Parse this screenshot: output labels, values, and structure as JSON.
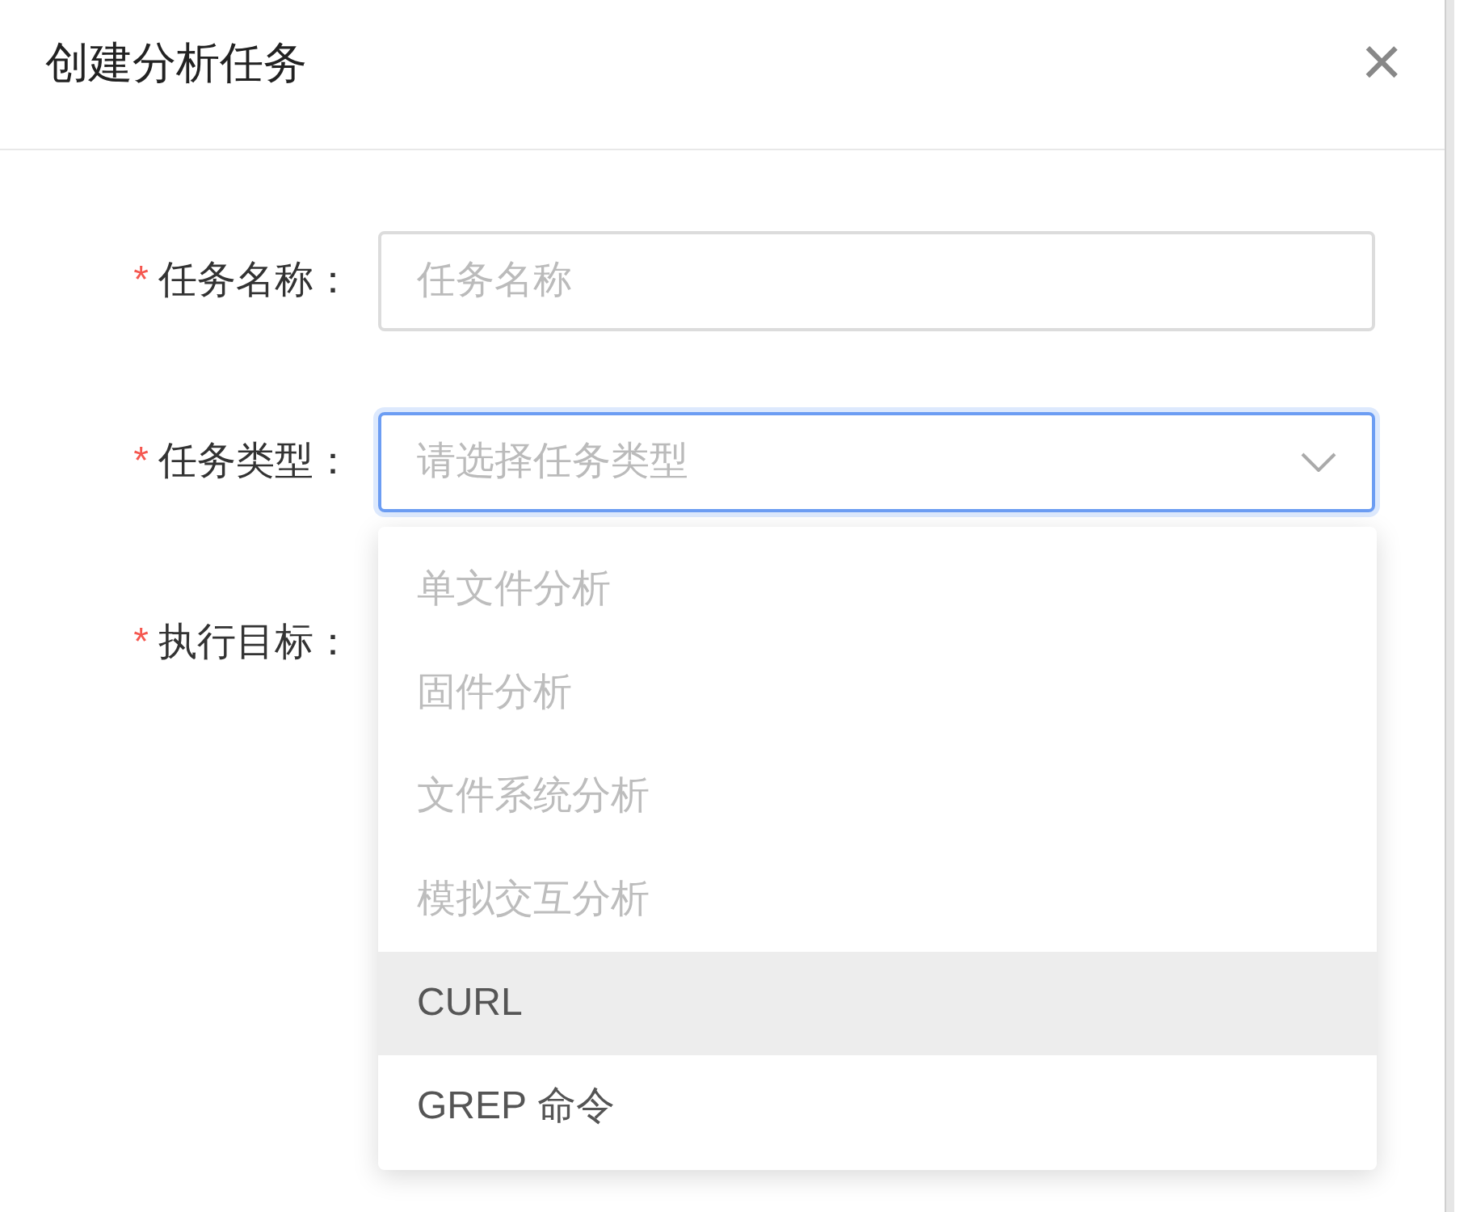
{
  "dialog": {
    "title": "创建分析任务",
    "close": "×"
  },
  "fields": [
    {
      "required_mark": "*",
      "label": "任务名称：",
      "kind": "input",
      "placeholder": "任务名称"
    },
    {
      "required_mark": "*",
      "label": "任务类型：",
      "kind": "select",
      "placeholder": "请选择任务类型",
      "focused": true
    },
    {
      "required_mark": "*",
      "label": "执行目标：",
      "kind": "none"
    }
  ],
  "dropdown": {
    "options": [
      {
        "label": "单文件分析",
        "disabled": true,
        "highlighted": false
      },
      {
        "label": "固件分析",
        "disabled": true,
        "highlighted": false
      },
      {
        "label": "文件系统分析",
        "disabled": true,
        "highlighted": false
      },
      {
        "label": "模拟交互分析",
        "disabled": true,
        "highlighted": false
      },
      {
        "label": "CURL",
        "disabled": false,
        "highlighted": true
      },
      {
        "label": "GREP 命令",
        "disabled": false,
        "highlighted": false
      }
    ]
  }
}
